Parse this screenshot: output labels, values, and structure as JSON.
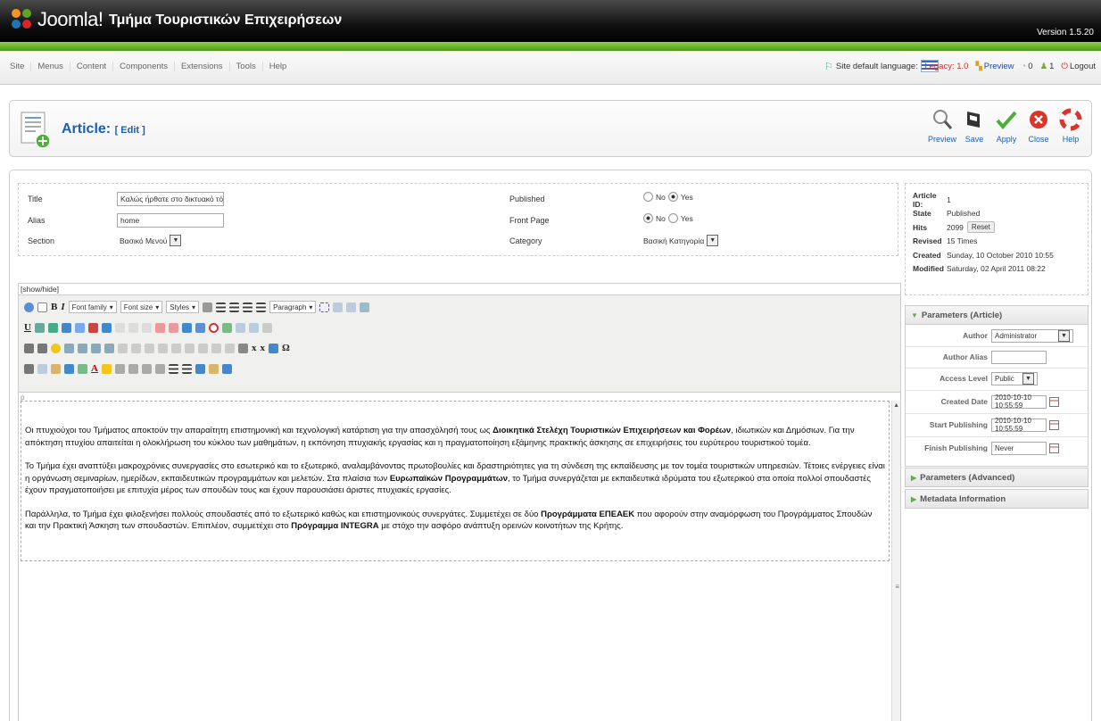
{
  "header": {
    "logo_text": "Joomla!",
    "site_title": "Τμήμα Τουριστικών Επιχειρήσεων",
    "version": "Version 1.5.20"
  },
  "menu": {
    "items": [
      "Site",
      "Menus",
      "Content",
      "Components",
      "Extensions",
      "Tools",
      "Help"
    ],
    "site_language_label": "Site default language:",
    "legacy": "Legacy: 1.0",
    "preview": "Preview",
    "messages_count": "0",
    "users_count": "1",
    "logout": "Logout"
  },
  "toolbar": {
    "title": "Article:",
    "title_suffix": "[ Edit ]",
    "buttons": [
      "Preview",
      "Save",
      "Apply",
      "Close",
      "Help"
    ]
  },
  "form": {
    "title_label": "Title",
    "title_value": "Καλώς ήρθατε στο δικτυακό τόπο το",
    "alias_label": "Alias",
    "alias_value": "home",
    "section_label": "Section",
    "section_value": "Βασικό Μενού",
    "published_label": "Published",
    "frontpage_label": "Front Page",
    "category_label": "Category",
    "category_value": "Βασική Κατηγορία",
    "no": "No",
    "yes": "Yes",
    "published": "yes",
    "frontpage": "no"
  },
  "editor": {
    "show_hide": "[show/hide]",
    "font_family": "Font family",
    "font_size": "Font size",
    "styles": "Styles",
    "paragraph": "Paragraph",
    "p_marker": "p",
    "p1_a": "Οι πτυχιούχοι του Τμήματος αποκτούν την απαραίτητη επιστημονική και τεχνολογική κατάρτιση για την απασχόλησή τους ως ",
    "p1_b": "Διοικητικά Στελέχη Τουριστικών Επιχειρήσεων και Φορέων",
    "p1_c": ", ιδιωτικών και Δημόσιων. Για την απόκτηση πτυχίου απαιτείται η ολοκλήρωση του κύκλου των μαθημάτων, η εκπόνηση πτυχιακής εργασίας και η πραγματοποίηση εξάμηνης πρακτικής άσκησης σε επιχειρήσεις του ευρύτερου τουριστικού τομέα.",
    "p2_a": "Το Τμήμα έχει αναπτύξει μακροχρόνιες συνεργασίες στο εσωτερικό και το εξωτερικό, αναλαμβάνοντας πρωτοβουλίες και δραστηριότητες για τη σύνδεση της εκπαίδευσης με τον τομέα τουριστικών υπηρεσιών. Τέτοιες ενέργειες είναι η οργάνωση σεμιναρίων, ημερίδων, εκπαιδευτικών προγραμμάτων και μελετών. Στα πλαίσια των ",
    "p2_b": "Ευρωπαϊκών Προγραμμάτων",
    "p2_c": ", το Τμήμα συνεργάζεται με εκπαιδευτικά ιδρύματα του εξωτερικού στα οποία πολλοί σπουδαστές έχουν πραγματοποιήσει με επιτυχία μέρος των σπουδών τους και έχουν παρουσιάσει άριστες πτυχιακές εργασίες.",
    "p3_a": "Παράλληλα, το Τμήμα έχει φιλοξενήσει πολλούς σπουδαστές από το εξωτερικό καθώς και επιστημονικούς συνεργάτες. Συμμετέχει σε δύο ",
    "p3_b": "Προγράμματα ΕΠΕΑΕΚ",
    "p3_c": " που αφορούν στην αναμόρφωση του Προγράμματος Σπουδών και την Πρακτική Άσκηση των σπουδαστών. Επιπλέον, συμμετέχει στο ",
    "p3_d": "Πρόγραμμα INTEGRA",
    "p3_e": " με στόχο την ασφόρο ανάπτυξη ορεινών κοινοτήτων της Κρήτης."
  },
  "info": {
    "rows": [
      {
        "k": "Article ID:",
        "v": "1"
      },
      {
        "k": "State",
        "v": "Published"
      },
      {
        "k": "Hits",
        "v": "2099"
      },
      {
        "k": "Revised",
        "v": "15 Times"
      },
      {
        "k": "Created",
        "v": "Sunday, 10 October 2010 10:55"
      },
      {
        "k": "Modified",
        "v": "Saturday, 02 April 2011 08:22"
      }
    ],
    "reset": "Reset"
  },
  "params": {
    "title": "Parameters (Article)",
    "author_label": "Author",
    "author_value": "Administrator",
    "alias_label": "Author Alias",
    "access_label": "Access Level",
    "access_value": "Public",
    "created_label": "Created Date",
    "created_value": "2010-10-10 10:55:59",
    "start_label": "Start Publishing",
    "start_value": "2010-10-10 10:55:59",
    "finish_label": "Finish Publishing",
    "finish_value": "Never",
    "advanced": "Parameters (Advanced)",
    "metadata": "Metadata Information"
  }
}
